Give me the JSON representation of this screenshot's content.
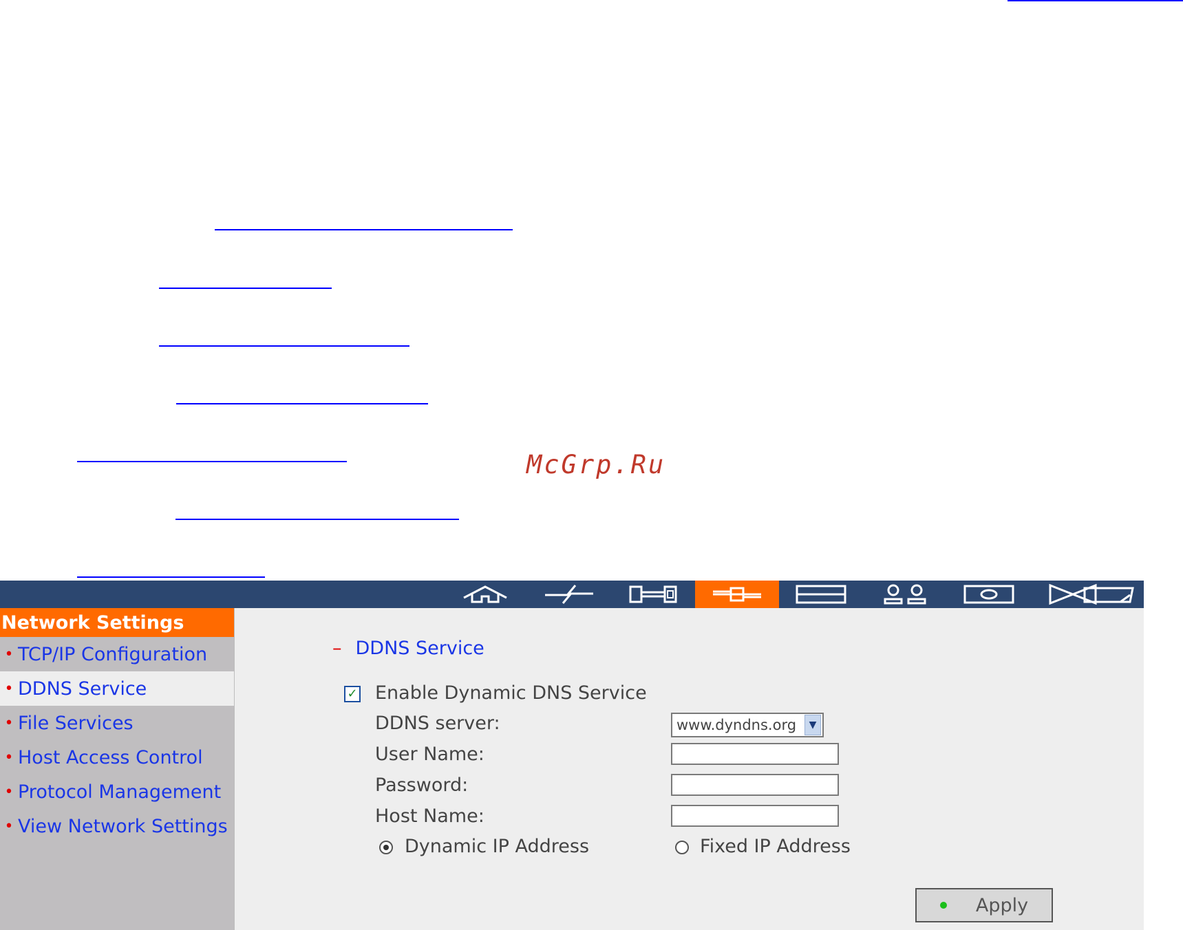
{
  "watermark": "McGrp.Ru",
  "nav": {
    "icons": [
      "home-icon",
      "quick-config-icon",
      "system-tools-icon",
      "network-icon",
      "device-icon",
      "users-icon",
      "share-icon",
      "backup-icon",
      "status-icon"
    ],
    "active": "network-icon"
  },
  "sidebar": {
    "title": "Network Settings",
    "items": [
      {
        "label": "TCP/IP Configuration"
      },
      {
        "label": "DDNS Service"
      },
      {
        "label": "File Services"
      },
      {
        "label": "Host Access Control"
      },
      {
        "label": "Protocol Management"
      },
      {
        "label": "View Network Settings"
      }
    ]
  },
  "main": {
    "section_dash": "–",
    "section_title": "DDNS Service",
    "enable_label": "Enable Dynamic DNS Service",
    "enable_checked": true,
    "server_label": "DDNS server:",
    "server_value": "www.dyndns.org",
    "username_label": "User Name:",
    "password_label": "Password:",
    "hostname_label": "Host Name:",
    "radio_dynamic": "Dynamic IP Address",
    "radio_fixed": "Fixed IP Address",
    "selected_radio": "dynamic",
    "apply_label": "Apply"
  }
}
